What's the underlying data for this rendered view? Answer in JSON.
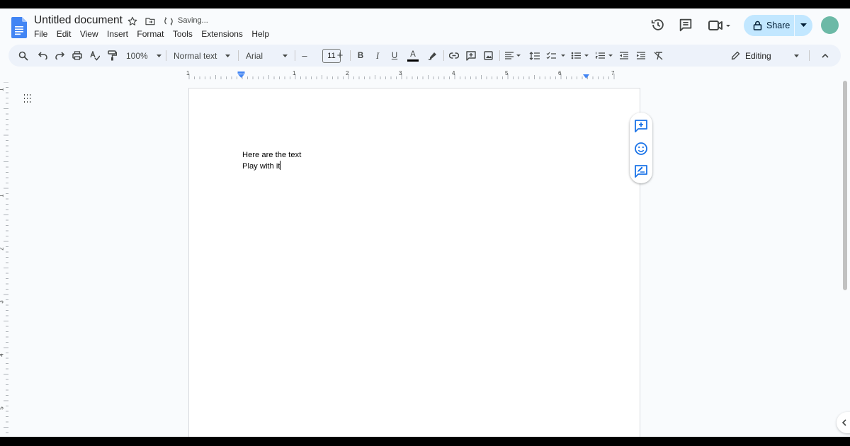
{
  "header": {
    "title": "Untitled document",
    "saving_status": "Saving...",
    "menu": [
      "File",
      "Edit",
      "View",
      "Insert",
      "Format",
      "Tools",
      "Extensions",
      "Help"
    ],
    "share_label": "Share",
    "avatar_color": "#6cb9a6"
  },
  "toolbar": {
    "zoom": "100%",
    "paragraph_style": "Normal text",
    "font_family": "Arial",
    "font_size": "11",
    "decrease_font": "–",
    "increase_font": "+",
    "bold": "B",
    "italic": "I",
    "underline": "U",
    "text_color": "A",
    "mode": "Editing"
  },
  "ruler": {
    "numbers": [
      "1",
      "1",
      "2",
      "3",
      "4",
      "5",
      "6",
      "7"
    ]
  },
  "vertical_ruler": {
    "numbers": [
      "1",
      "1",
      "2",
      "3",
      "4",
      "5"
    ]
  },
  "document": {
    "lines": [
      "Here are the text",
      "Play with it"
    ]
  },
  "colors": {
    "accent": "#1a73e8",
    "share_bg": "#c2e7ff",
    "toolbar_bg": "#edf2fa",
    "page_bg": "#ffffff",
    "app_bg": "#f9fbfd"
  }
}
